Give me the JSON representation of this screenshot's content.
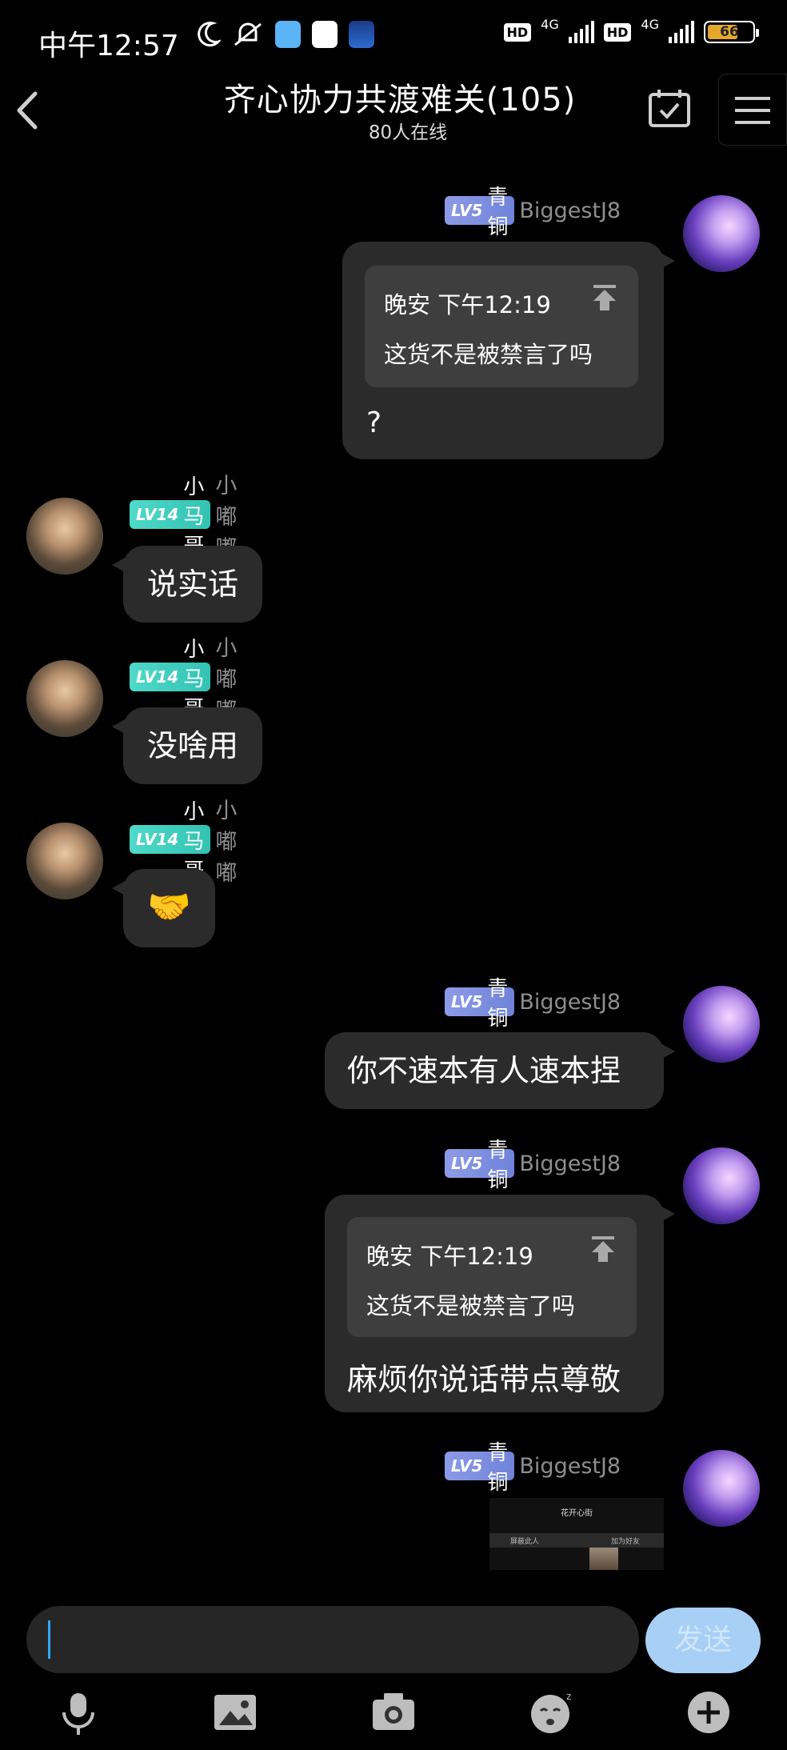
{
  "status_bar": {
    "time": "中午12:57",
    "net1": "4G",
    "net2": "4G",
    "hd1": "HD",
    "hd2": "HD",
    "battery": "66"
  },
  "header": {
    "title": "齐心协力共渡难关(105)",
    "subtitle": "80人在线"
  },
  "messages": [
    {
      "level": "LV5",
      "rank": "青铜",
      "nick": "BiggestJ8",
      "quote_head": "晚安  下午12:19",
      "quote_body": "这货不是被禁言了吗",
      "text": "?"
    },
    {
      "level": "LV14",
      "rank": "小马哥",
      "nick": "小嘟嘟",
      "text": "说实话"
    },
    {
      "level": "LV14",
      "rank": "小马哥",
      "nick": "小嘟嘟",
      "text": "没啥用"
    },
    {
      "level": "LV14",
      "rank": "小马哥",
      "nick": "小嘟嘟",
      "text": "🤝"
    },
    {
      "level": "LV5",
      "rank": "青铜",
      "nick": "BiggestJ8",
      "text": "你不速本有人速本捏"
    },
    {
      "level": "LV5",
      "rank": "青铜",
      "nick": "BiggestJ8",
      "quote_head": "晚安  下午12:19",
      "quote_body": "这货不是被禁言了吗",
      "text": "麻烦你说话带点尊敬"
    },
    {
      "level": "LV5",
      "rank": "青铜",
      "nick": "BiggestJ8",
      "image": {
        "top_title": "花开心街",
        "action1": "屏蔽此人",
        "action2": "加为好友"
      }
    }
  ],
  "input": {
    "send_label": "发送"
  },
  "toolbar": [
    "mic-icon",
    "image-icon",
    "camera-icon",
    "emoji-icon",
    "plus-icon"
  ]
}
